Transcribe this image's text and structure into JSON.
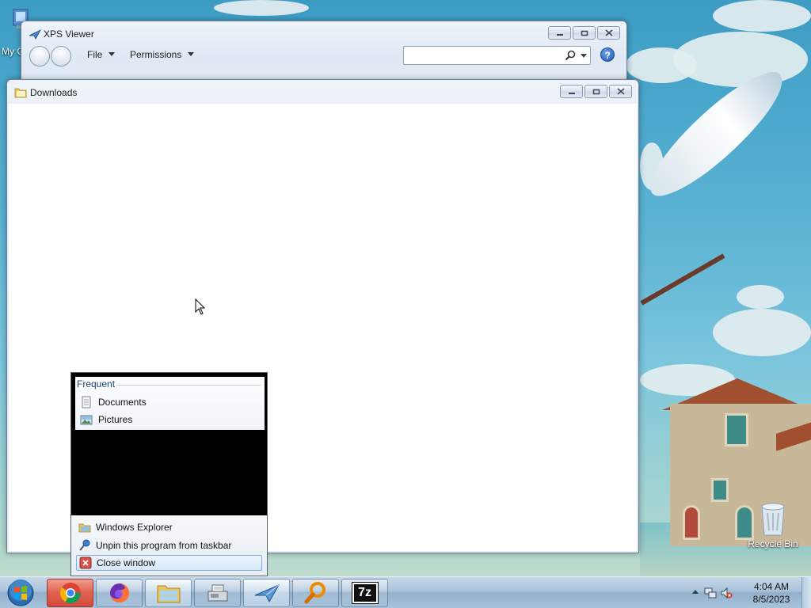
{
  "desktop": {
    "icons": [
      {
        "label": "My C",
        "icon": "computer-icon"
      },
      {
        "label": "Recycle Bin",
        "icon": "recycle-bin-icon"
      }
    ]
  },
  "xps_window": {
    "title": "XPS Viewer",
    "menus": [
      {
        "label": "File"
      },
      {
        "label": "Permissions"
      }
    ],
    "search": {
      "value": "",
      "placeholder": ""
    },
    "help_label": "?"
  },
  "downloads_window": {
    "title": "Downloads"
  },
  "jumplist": {
    "frequent_header": "Frequent",
    "frequent_items": [
      {
        "label": "Documents",
        "icon": "documents-icon"
      },
      {
        "label": "Pictures",
        "icon": "pictures-icon"
      }
    ],
    "tasks": [
      {
        "label": "Windows Explorer",
        "icon": "folder-icon"
      },
      {
        "label": "Unpin this program from taskbar",
        "icon": "unpin-icon"
      },
      {
        "label": "Close window",
        "icon": "close-window-icon",
        "highlighted": true
      }
    ]
  },
  "taskbar": {
    "buttons": [
      {
        "name": "chrome",
        "icon": "chrome-icon"
      },
      {
        "name": "firefox",
        "icon": "firefox-icon"
      },
      {
        "name": "windows-explorer",
        "icon": "folder-icon"
      },
      {
        "name": "fax-and-scan",
        "icon": "fax-icon"
      },
      {
        "name": "xps-viewer",
        "icon": "xps-viewer-icon"
      },
      {
        "name": "search",
        "icon": "magnifier-icon"
      },
      {
        "name": "7-zip",
        "icon": "7zip-icon",
        "text": "7z"
      }
    ],
    "clock": {
      "time": "4:04 AM",
      "date": "8/5/2023"
    }
  }
}
